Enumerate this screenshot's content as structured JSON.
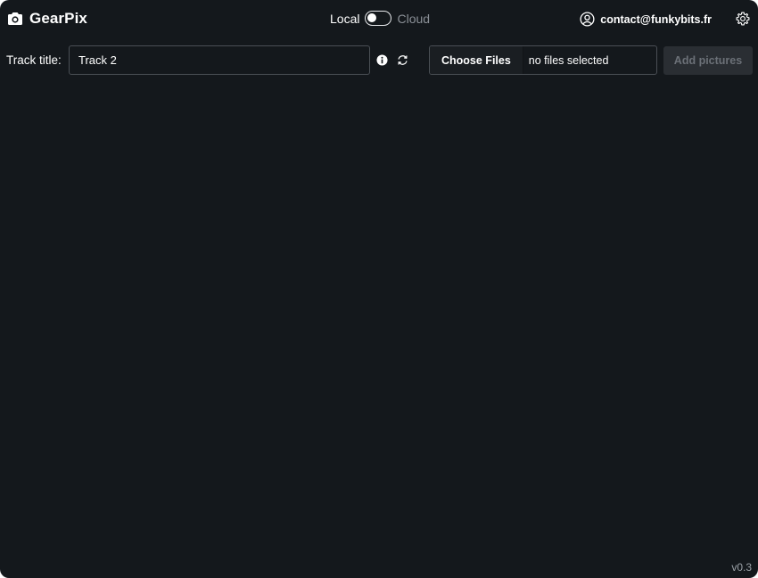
{
  "app": {
    "name": "GearPix",
    "version": "v0.3"
  },
  "mode": {
    "local_label": "Local",
    "cloud_label": "Cloud",
    "selected": "Local"
  },
  "account": {
    "email": "contact@funkybits.fr"
  },
  "track": {
    "label": "Track title:",
    "value": "Track 2"
  },
  "files": {
    "choose_label": "Choose Files",
    "status": "no files selected"
  },
  "actions": {
    "add_pictures_label": "Add pictures"
  },
  "icons": {
    "brand": "camera-icon",
    "account": "user-circle-icon",
    "settings": "gear-icon",
    "info": "info-icon",
    "refresh": "refresh-icon"
  },
  "colors": {
    "background": "#14181c",
    "text": "#ffffff",
    "muted": "#8a8f96",
    "disabled_button_bg": "#2a2e33"
  }
}
